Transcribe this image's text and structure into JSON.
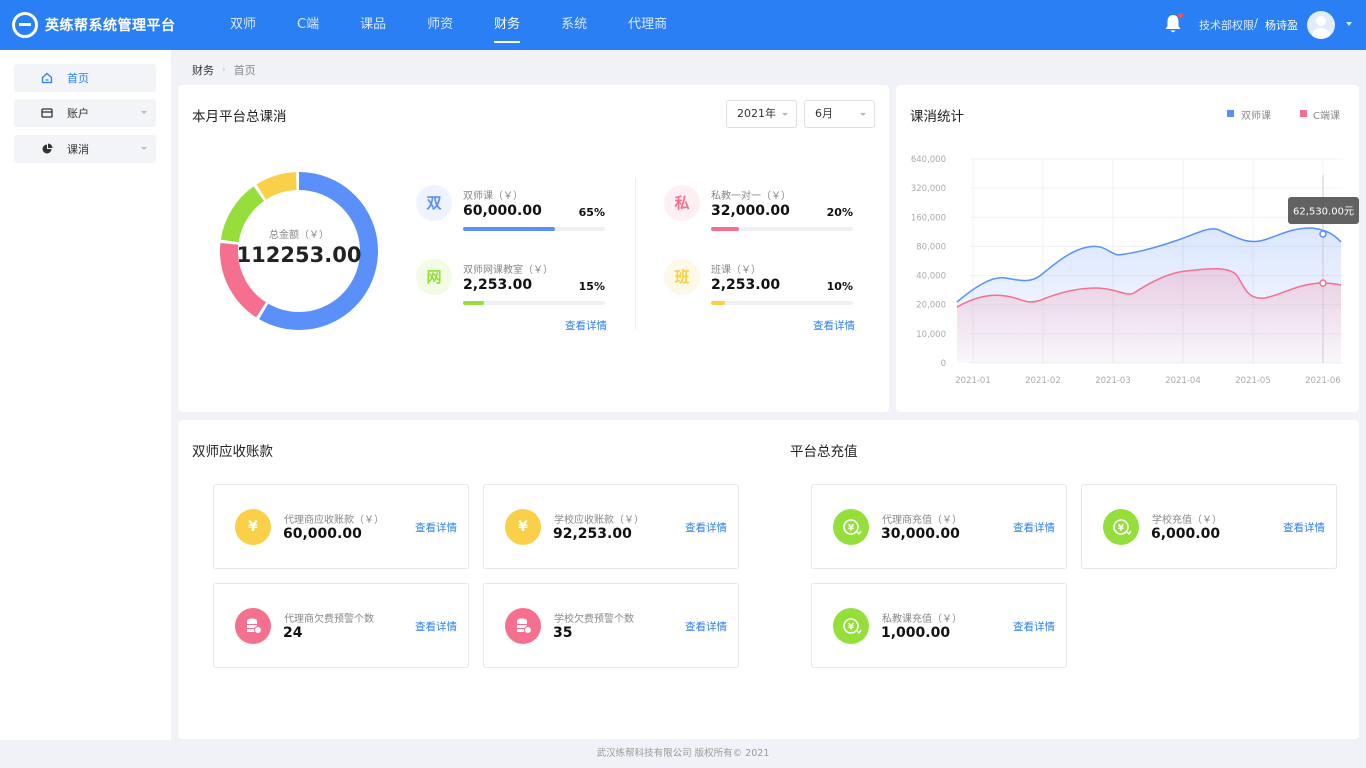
{
  "app": {
    "title": "英练帮系统管理平台"
  },
  "nav": [
    "双师",
    "C端",
    "课品",
    "师资",
    "财务",
    "系统",
    "代理商"
  ],
  "header": {
    "permission": "技术部权限",
    "separator": "/",
    "user": "杨诗盈"
  },
  "sidebar": {
    "items": [
      {
        "label": "首页",
        "icon": "home-icon"
      },
      {
        "label": "账户",
        "icon": "wallet-icon"
      },
      {
        "label": "课消",
        "icon": "pie-chart-icon"
      }
    ]
  },
  "breadcrumb": {
    "root": "财务",
    "current": "首页"
  },
  "summary": {
    "title": "本月平台总课消",
    "year": "2021年",
    "month": "6月",
    "total_label": "总金额（￥）",
    "total": "112253.00",
    "categories": [
      {
        "badge": "双",
        "label": "双师课（￥）",
        "value": "60,000.00",
        "percent": "65%",
        "ratio": 0.65,
        "color": "#5b8ff9"
      },
      {
        "badge": "网",
        "label": "双师网课教室（￥）",
        "value": "2,253.00",
        "percent": "15%",
        "ratio": 0.15,
        "color": "#95de3c"
      },
      {
        "badge": "私",
        "label": "私教一对一（￥）",
        "value": "32,000.00",
        "percent": "20%",
        "ratio": 0.2,
        "color": "#f5708f"
      },
      {
        "badge": "班",
        "label": "班课（￥）",
        "value": "2,253.00",
        "percent": "10%",
        "ratio": 0.1,
        "color": "#fad049"
      }
    ],
    "detail_link": "查看详情"
  },
  "chart": {
    "title": "课消统计",
    "tooltip": "62,530.00元",
    "chart_data": {
      "type": "area",
      "categories": [
        "2021-01",
        "2021-02",
        "2021-03",
        "2021-04",
        "2021-05",
        "2021-06"
      ],
      "y_ticks": [
        "0",
        "10,000",
        "20,000",
        "40,000",
        "80,000",
        "160,000",
        "320,000",
        "640,000"
      ],
      "series": [
        {
          "name": "双师课",
          "color": "#5b8ff9"
        },
        {
          "name": "C端课",
          "color": "#f5708f"
        }
      ],
      "grid": true,
      "legend": "top-right"
    }
  },
  "receivables": {
    "title": "双师应收账款",
    "items": [
      {
        "label": "代理商应收账款（￥）",
        "value": "60,000.00",
        "icon": "yuan-icon",
        "color": "#fad049"
      },
      {
        "label": "学校应收账款（￥）",
        "value": "92,253.00",
        "icon": "yuan-icon",
        "color": "#fad049"
      },
      {
        "label": "代理商欠费预警个数",
        "value": "24",
        "icon": "coins-warning-icon",
        "color": "#f5708f"
      },
      {
        "label": "学校欠费预警个数",
        "value": "35",
        "icon": "coins-warning-icon",
        "color": "#f5708f"
      }
    ]
  },
  "recharge": {
    "title": "平台总充值",
    "items": [
      {
        "label": "代理商充值（￥）",
        "value": "30,000.00",
        "icon": "recharge-icon",
        "color": "#95de3c"
      },
      {
        "label": "学校充值（￥）",
        "value": "6,000.00",
        "icon": "recharge-icon",
        "color": "#95de3c"
      },
      {
        "label": "私教课充值（￥）",
        "value": "1,000.00",
        "icon": "recharge-icon",
        "color": "#95de3c"
      }
    ]
  },
  "footer": "武汉练帮科技有限公司 版权所有© 2021"
}
